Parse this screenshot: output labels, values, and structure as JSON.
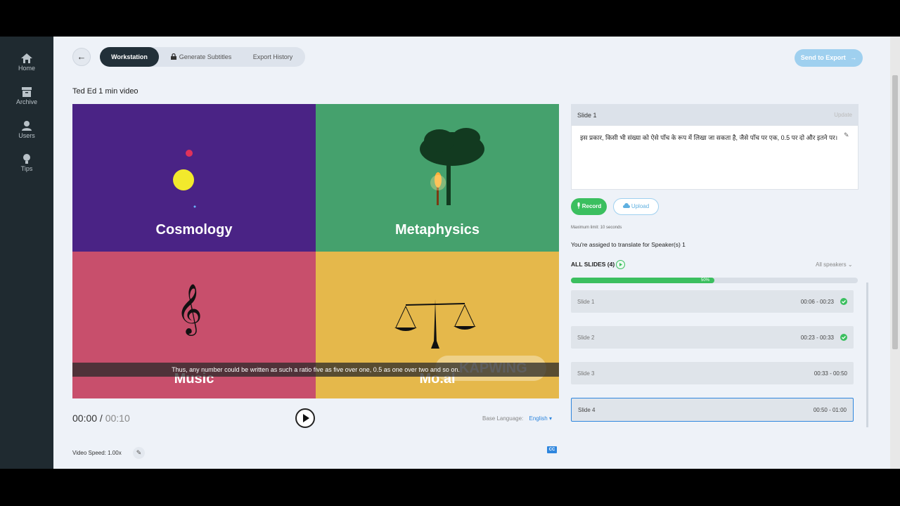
{
  "sidebar": {
    "items": [
      {
        "label": "Home",
        "icon": "home-icon"
      },
      {
        "label": "Archive",
        "icon": "archive-icon"
      },
      {
        "label": "Users",
        "icon": "users-icon"
      },
      {
        "label": "Tips",
        "icon": "tips-icon"
      }
    ]
  },
  "header": {
    "back_icon": "←",
    "tabs": [
      "Workstation",
      "Generate Subtitles",
      "Export History"
    ],
    "send_label": "Send to Export",
    "send_icon": "→"
  },
  "video": {
    "title": "Ted Ed 1 min video",
    "quadrants": [
      "Cosmology",
      "Metaphysics",
      "Music",
      "Mo.al"
    ],
    "subtitle": "Thus, any number could be written as such a ratio five as five over one, 0.5 as one over two and so on.",
    "watermark": "KAPWING",
    "current_time": "00:00",
    "separator": " / ",
    "total_time": "00:10",
    "base_language_label": "Base Language:",
    "base_language_value": "English",
    "dropdown_arrow": "▾",
    "speed_label": "Video Speed: 1.00x",
    "cc_label": "CC"
  },
  "slide_editor": {
    "title": "Slide 1",
    "update_label": "Update",
    "text": "इस प्रकार, किसी भी संख्या को ऐसे पाँच के रूप में लिखा जा सकता है, जैसे पाँच पर एक, 0.5 पर दो और इतने पर।",
    "record_label": "Record",
    "upload_label": "Upload",
    "max_limit": "Maximum limit: 10 seconds",
    "assigned": "You're assiged to translate for Speaker(s) 1"
  },
  "slides": {
    "header": "ALL SLIDES (4)",
    "filter": "All speakers",
    "filter_arrow": "⌄",
    "progress_percent": 50,
    "progress_label": "50%",
    "items": [
      {
        "name": "Slide 1",
        "range": "00:06 - 00:23",
        "done": true
      },
      {
        "name": "Slide 2",
        "range": "00:23 - 00:33",
        "done": true
      },
      {
        "name": "Slide 3",
        "range": "00:33 - 00:50",
        "done": false
      },
      {
        "name": "Slide 4",
        "range": "00:50 - 01:00",
        "done": false
      }
    ]
  },
  "colors": {
    "sidebar": "#1f2a30",
    "accent_green": "#3bbf5f",
    "accent_blue": "#2e86de",
    "cosmology": "#4a2385",
    "metaphysics": "#45a16d",
    "music": "#c84f6c",
    "moral": "#e5b84b"
  }
}
